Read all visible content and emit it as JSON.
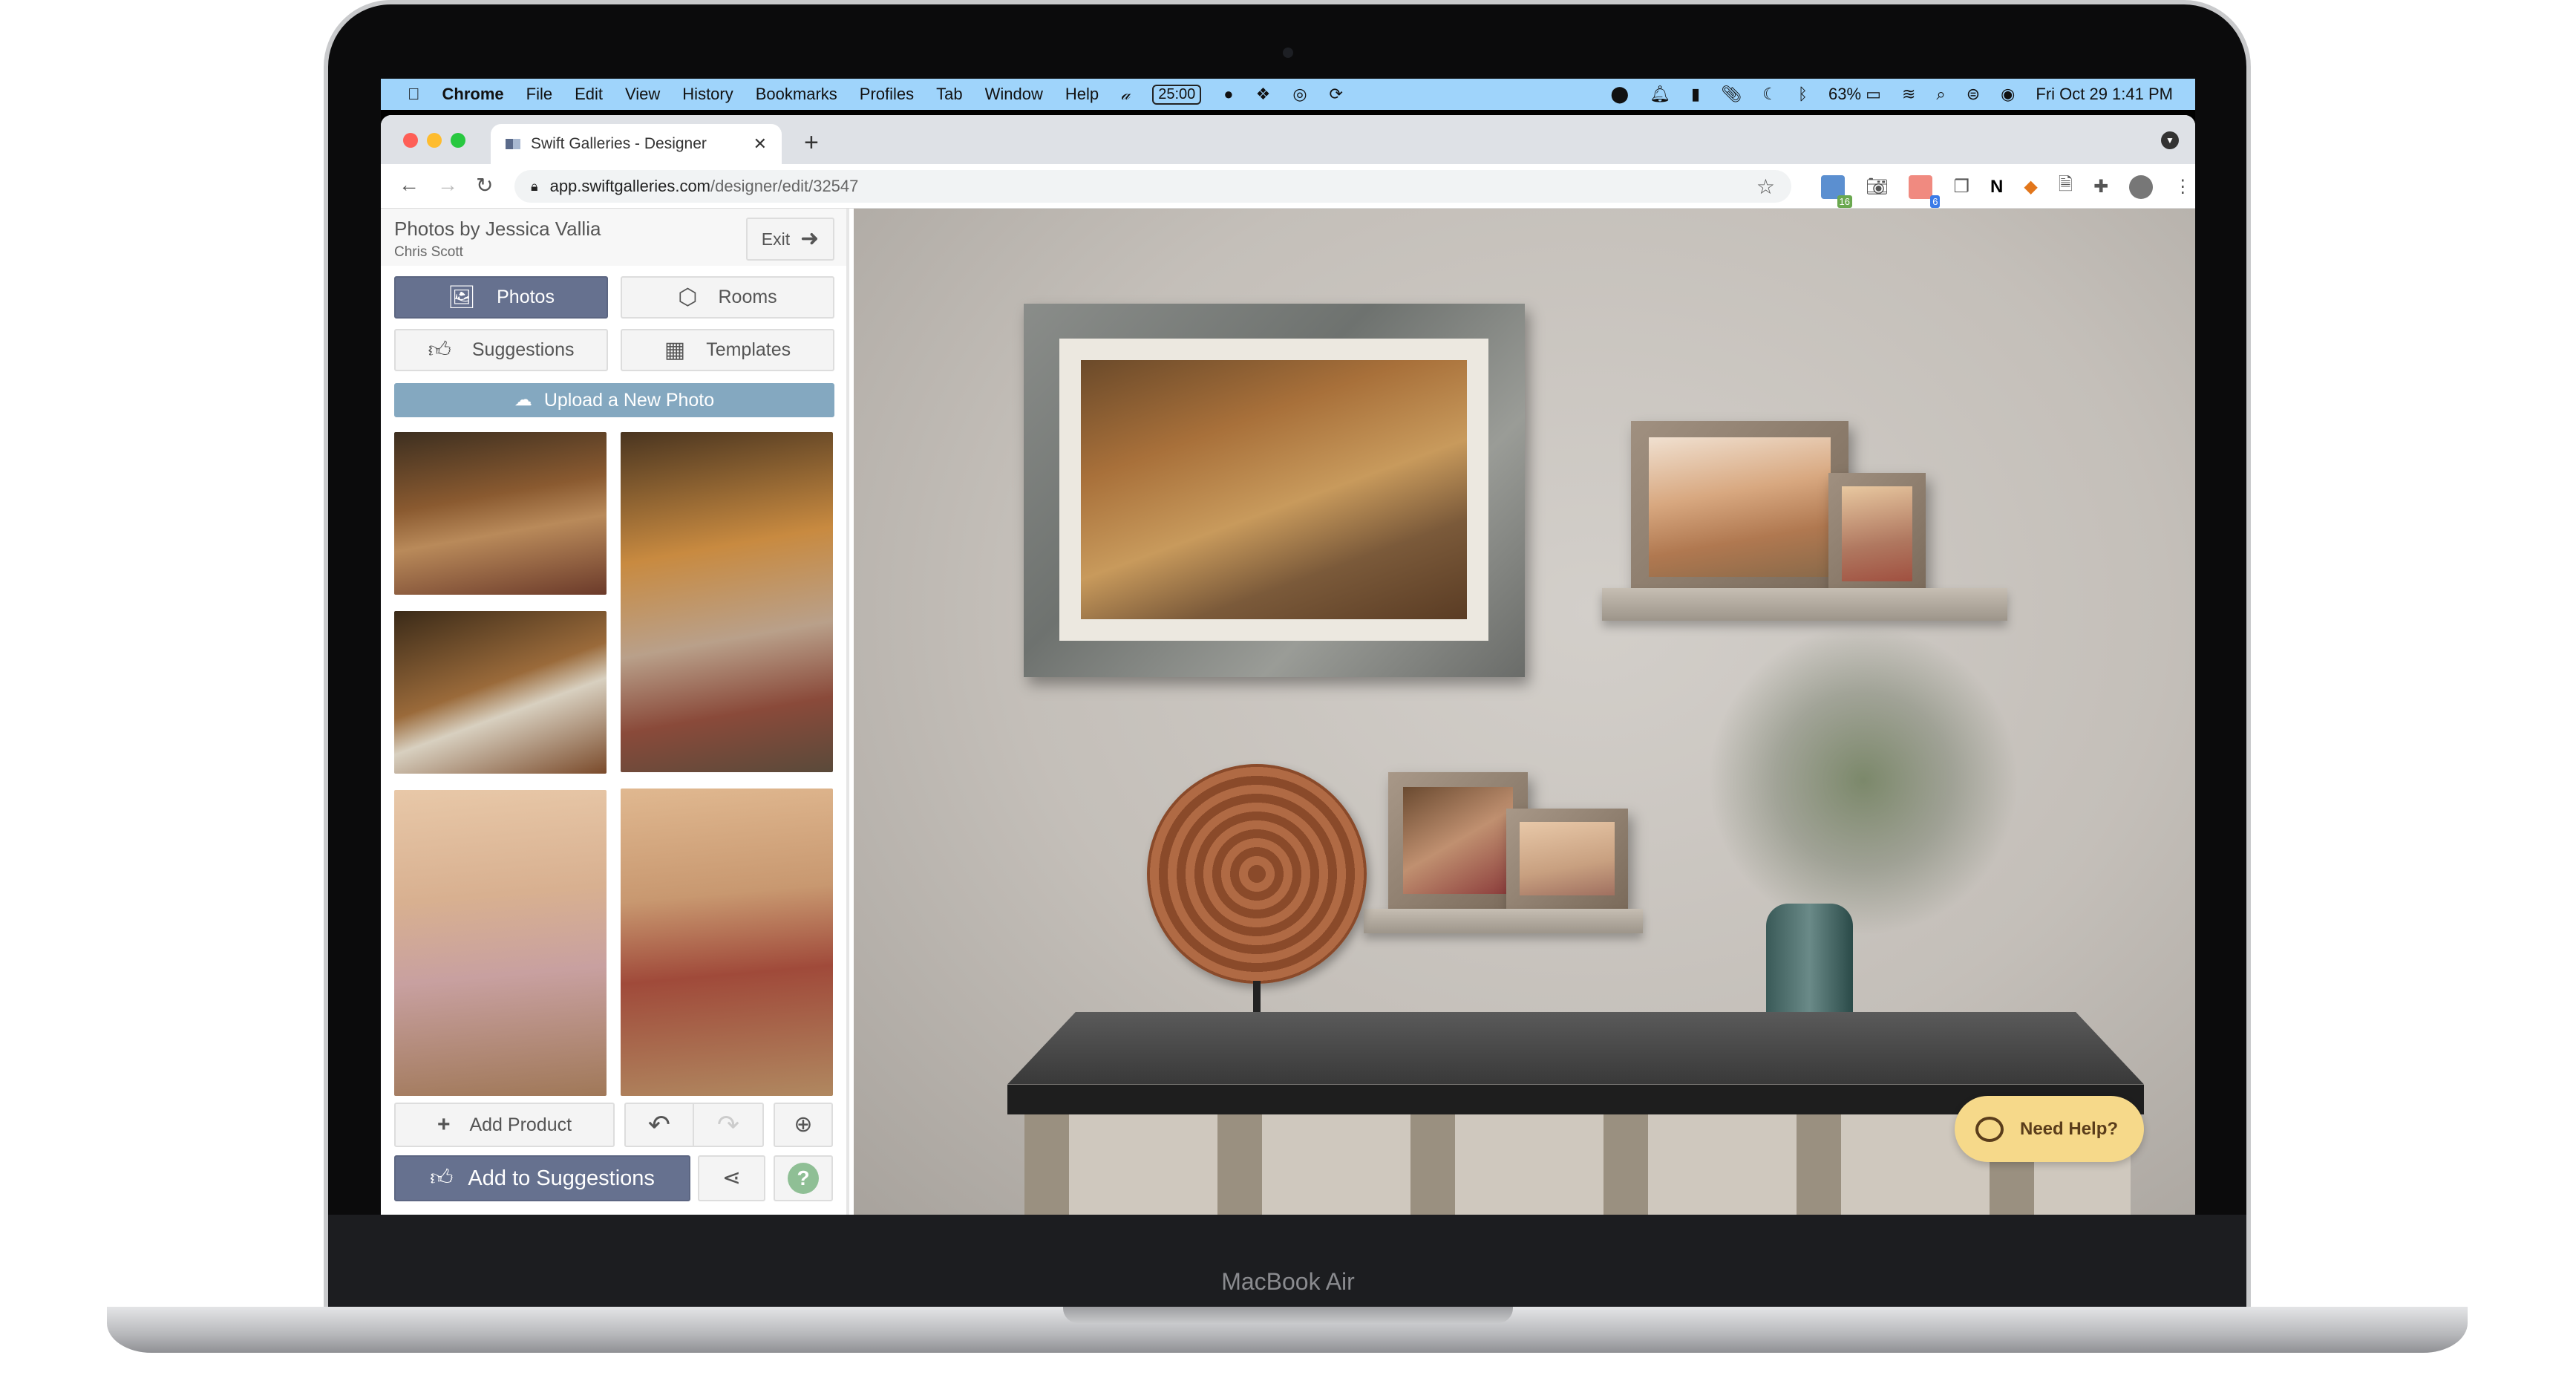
{
  "menubar": {
    "app": "Chrome",
    "items": [
      "File",
      "Edit",
      "View",
      "History",
      "Bookmarks",
      "Profiles",
      "Tab",
      "Window",
      "Help"
    ],
    "timer": "25:00",
    "battery": "63%",
    "datetime": "Fri Oct 29  1:41 PM"
  },
  "browser": {
    "tab_title": "Swift Galleries - Designer",
    "url_host": "app.swiftgalleries.com",
    "url_path": "/designer/edit/32547",
    "ext_badges": [
      "16",
      "6"
    ]
  },
  "sidebar": {
    "title": "Photos by Jessica Vallia",
    "subtitle": "Chris Scott",
    "exit_label": "Exit",
    "tabs": [
      {
        "label": "Photos",
        "active": true
      },
      {
        "label": "Rooms"
      },
      {
        "label": "Suggestions"
      },
      {
        "label": "Templates"
      }
    ],
    "upload_label": "Upload a New Photo",
    "add_product_label": "Add Product",
    "add_suggestions_label": "Add to Suggestions"
  },
  "help": {
    "label": "Need Help?"
  },
  "device": {
    "brand": "MacBook Air"
  },
  "colors": {
    "primary": "#66718f",
    "upload": "#84a8c0",
    "help_bg": "#f6d98a",
    "help_icon": "#8fbf95",
    "menubar": "#9fd4fb"
  }
}
